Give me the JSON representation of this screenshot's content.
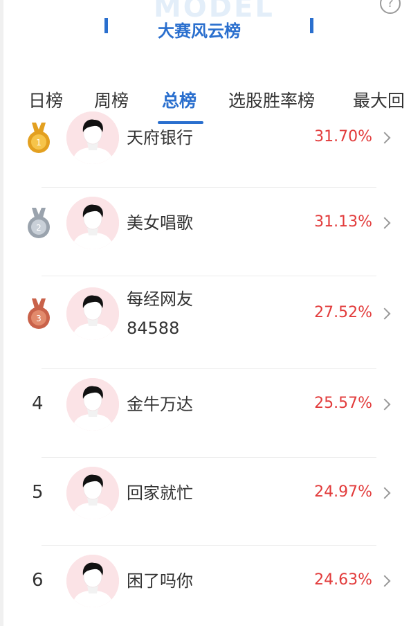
{
  "header": {
    "watermark": "MODEL",
    "title": "大赛风云榜",
    "help_label": "?"
  },
  "tabs": [
    {
      "label": "日榜",
      "active": false
    },
    {
      "label": "周榜",
      "active": false
    },
    {
      "label": "总榜",
      "active": true
    },
    {
      "label": "选股胜率榜",
      "active": false
    },
    {
      "label": "最大回",
      "active": false
    }
  ],
  "ranking": [
    {
      "rank": "1",
      "medal": "gold-medal-icon",
      "name_lines": [
        "天府银行"
      ],
      "percent": "31.70%"
    },
    {
      "rank": "2",
      "medal": "silver-medal-icon",
      "name_lines": [
        "美女唱歌"
      ],
      "percent": "31.13%"
    },
    {
      "rank": "3",
      "medal": "bronze-medal-icon",
      "name_lines": [
        "每经网友",
        "84588"
      ],
      "percent": "27.52%"
    },
    {
      "rank": "4",
      "medal": null,
      "name_lines": [
        "金牛万达"
      ],
      "percent": "25.57%"
    },
    {
      "rank": "5",
      "medal": null,
      "name_lines": [
        "回家就忙"
      ],
      "percent": "24.97%"
    },
    {
      "rank": "6",
      "medal": null,
      "name_lines": [
        "困了吗你"
      ],
      "percent": "24.63%"
    }
  ],
  "colors": {
    "accent": "#2a6fce",
    "percent": "#e23b3b",
    "gold": "#e3a020",
    "silver": "#9aa3ad",
    "bronze": "#c9624a",
    "avatar_bg": "#fbe3e6"
  }
}
